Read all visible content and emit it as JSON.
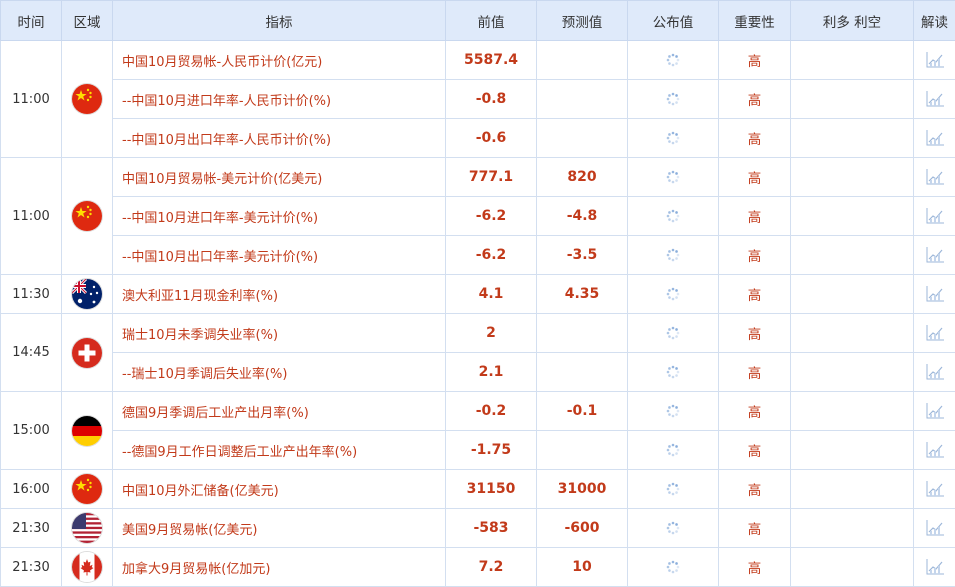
{
  "headers": {
    "time": "时间",
    "region": "区域",
    "indicator": "指标",
    "prev": "前值",
    "forecast": "预测值",
    "actual": "公布值",
    "importance": "重要性",
    "impact": "利多 利空",
    "analysis": "解读"
  },
  "groups": [
    {
      "time": "11:00",
      "flag": "china-flag-icon",
      "rows": [
        {
          "indicator": "中国10月贸易帐-人民币计价(亿元)",
          "prev": "5587.4",
          "forecast": "",
          "importance": "高"
        },
        {
          "indicator": "--中国10月进口年率-人民币计价(%)",
          "prev": "-0.8",
          "forecast": "",
          "importance": "高"
        },
        {
          "indicator": "--中国10月出口年率-人民币计价(%)",
          "prev": "-0.6",
          "forecast": "",
          "importance": "高"
        }
      ]
    },
    {
      "time": "11:00",
      "flag": "china-flag-icon",
      "rows": [
        {
          "indicator": "中国10月贸易帐-美元计价(亿美元)",
          "prev": "777.1",
          "forecast": "820",
          "importance": "高"
        },
        {
          "indicator": "--中国10月进口年率-美元计价(%)",
          "prev": "-6.2",
          "forecast": "-4.8",
          "importance": "高"
        },
        {
          "indicator": "--中国10月出口年率-美元计价(%)",
          "prev": "-6.2",
          "forecast": "-3.5",
          "importance": "高"
        }
      ]
    },
    {
      "time": "11:30",
      "flag": "australia-flag-icon",
      "rows": [
        {
          "indicator": "澳大利亚11月现金利率(%)",
          "prev": "4.1",
          "forecast": "4.35",
          "importance": "高"
        }
      ]
    },
    {
      "time": "14:45",
      "flag": "switzerland-flag-icon",
      "rows": [
        {
          "indicator": "瑞士10月未季调失业率(%)",
          "prev": "2",
          "forecast": "",
          "importance": "高"
        },
        {
          "indicator": "--瑞士10月季调后失业率(%)",
          "prev": "2.1",
          "forecast": "",
          "importance": "高"
        }
      ]
    },
    {
      "time": "15:00",
      "flag": "germany-flag-icon",
      "rows": [
        {
          "indicator": "德国9月季调后工业产出月率(%)",
          "prev": "-0.2",
          "forecast": "-0.1",
          "importance": "高"
        },
        {
          "indicator": "--德国9月工作日调整后工业产出年率(%)",
          "prev": "-1.75",
          "forecast": "",
          "importance": "高"
        }
      ]
    },
    {
      "time": "16:00",
      "flag": "china-flag-icon",
      "rows": [
        {
          "indicator": "中国10月外汇储备(亿美元)",
          "prev": "31150",
          "forecast": "31000",
          "importance": "高"
        }
      ]
    },
    {
      "time": "21:30",
      "flag": "usa-flag-icon",
      "rows": [
        {
          "indicator": "美国9月贸易帐(亿美元)",
          "prev": "-583",
          "forecast": "-600",
          "importance": "高"
        }
      ]
    },
    {
      "time": "21:30",
      "flag": "canada-flag-icon",
      "rows": [
        {
          "indicator": "加拿大9月贸易帐(亿加元)",
          "prev": "7.2",
          "forecast": "10",
          "importance": "高"
        }
      ]
    }
  ],
  "colors": {
    "header_bg": "#dfeafa",
    "value_red": "#c23a1a",
    "border": "#d3dff0"
  }
}
